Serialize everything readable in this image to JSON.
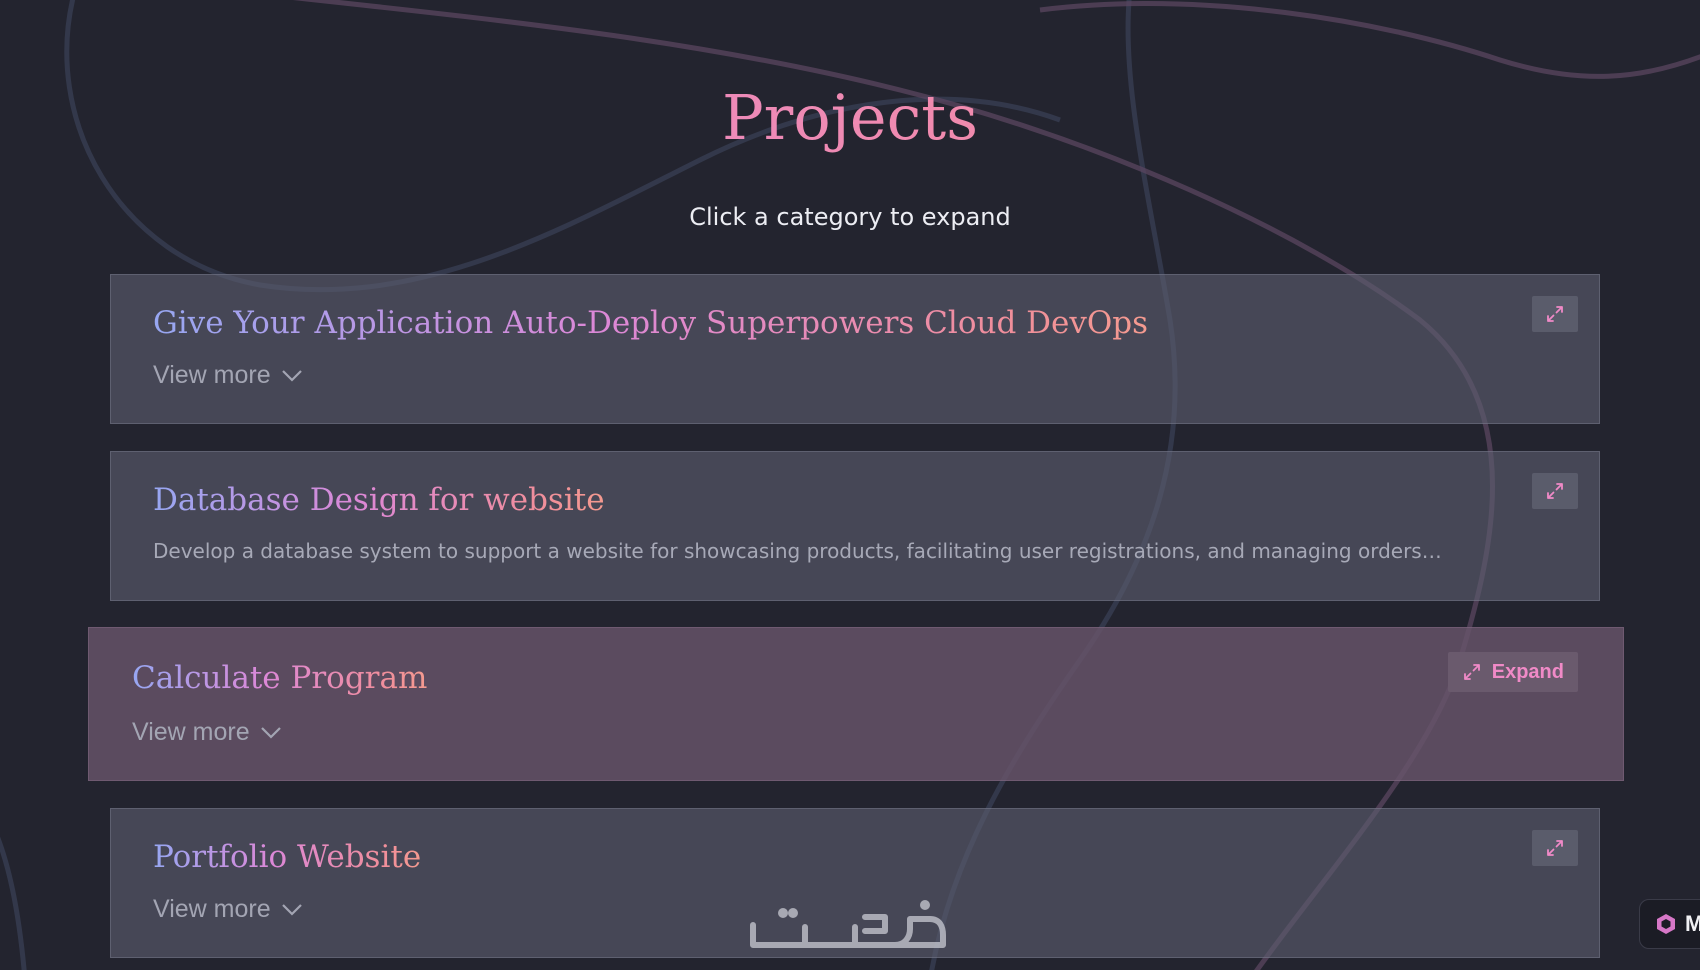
{
  "page": {
    "title": "Projects",
    "subtitle": "Click a category to expand"
  },
  "projects": [
    {
      "title": "Give Your Application Auto-Deploy Superpowers Cloud DevOps",
      "view_more_label": "View more",
      "expand_icon": "expand-arrows-icon"
    },
    {
      "title": "Database Design for website",
      "description": "Develop a database system to support a website for showcasing products, facilitating user registrations, and managing orders…",
      "expand_icon": "expand-arrows-icon"
    },
    {
      "title": "Calculate Program",
      "view_more_label": "View more",
      "expand_label": "Expand",
      "expand_icon": "expand-arrows-icon"
    },
    {
      "title": "Portfolio Website",
      "view_more_label": "View more",
      "expand_icon": "expand-arrows-icon"
    }
  ],
  "watermark": {
    "text": "خمسات"
  },
  "corner_badge": {
    "label": "M",
    "icon": "brand-cube-icon"
  },
  "colors": {
    "background": "#23242f",
    "card": "#50525f",
    "card_active": "#5e4f5f",
    "accent_pink": "#f08ac7",
    "title_gradient_start": "#97a7f2",
    "title_gradient_end": "#f49a8f"
  }
}
